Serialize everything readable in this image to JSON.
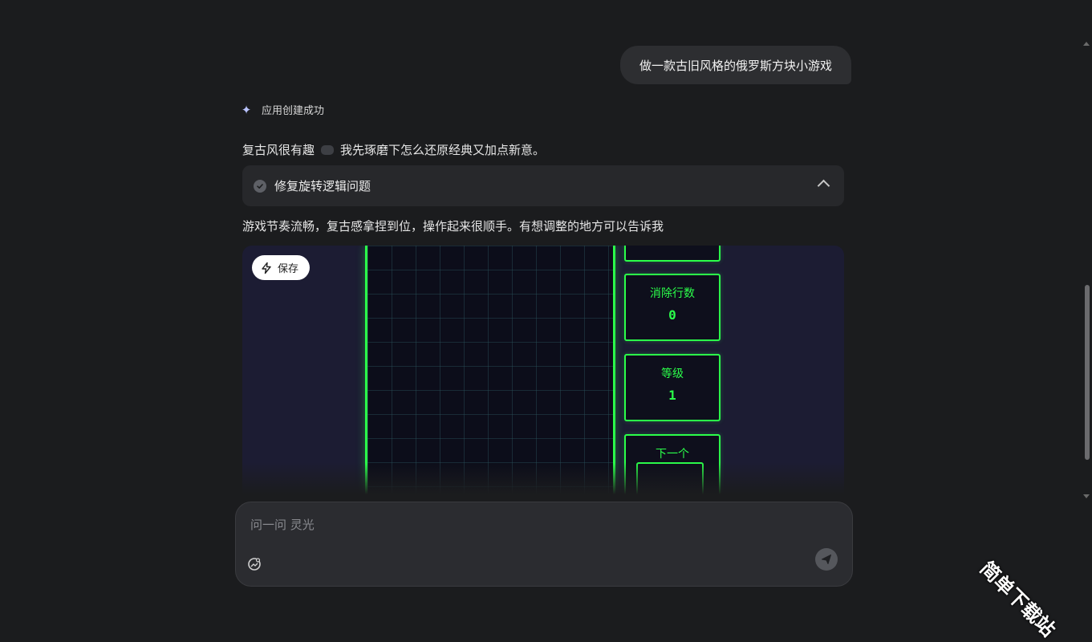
{
  "chat": {
    "user_message": "做一款古旧风格的俄罗斯方块小游戏",
    "status_text": "应用创建成功",
    "status_icon": "sparkle-icon",
    "reply_intro_before": "复古风很有趣",
    "reply_intro_emoji": "gamepad-icon",
    "reply_intro_after": "我先琢磨下怎么还原经典又加点新意。",
    "task": {
      "title": "修复旋转逻辑问题",
      "status": "completed",
      "expanded": true
    },
    "reply_summary": "游戏节奏流畅，复古感拿捏到位，操作起来很顺手。有想调整的地方可以告诉我"
  },
  "preview": {
    "save_label": "保存",
    "game": {
      "lines_label": "消除行数",
      "lines_value": "0",
      "level_label": "等级",
      "level_value": "1",
      "next_label": "下一个"
    },
    "colors": {
      "neon_green": "#2bff4a",
      "board_bg": "#0c0d1a",
      "preview_bg": "#1c1c33"
    }
  },
  "composer": {
    "placeholder": "问一问 灵光",
    "value": ""
  },
  "watermark": "简单下载站"
}
